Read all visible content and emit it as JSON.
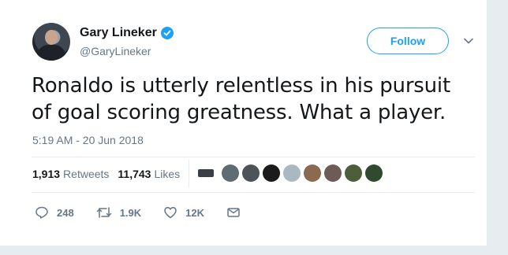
{
  "user": {
    "name": "Gary Lineker",
    "handle": "@GaryLineker"
  },
  "follow_label": "Follow",
  "tweet": {
    "text": "Ronaldo is utterly relentless in his pursuit of goal scoring greatness. What a player.",
    "timestamp": "5:19 AM - 20 Jun 2018"
  },
  "stats": {
    "retweets_count": "1,913",
    "retweets_label": "Retweets",
    "likes_count": "11,743",
    "likes_label": "Likes"
  },
  "actions": {
    "replies": "248",
    "retweets": "1.9K",
    "likes": "12K"
  },
  "liker_avatars": [
    {
      "color": "#3a3f45",
      "shape": "rect"
    },
    {
      "color": "#5d6d73"
    },
    {
      "color": "#4d5358"
    },
    {
      "color": "#1b1b1b"
    },
    {
      "color": "#aab8c2"
    },
    {
      "color": "#8b6a4f"
    },
    {
      "color": "#6e5b55"
    },
    {
      "color": "#4f5e3a"
    },
    {
      "color": "#2f4a2c"
    }
  ],
  "colors": {
    "accent": "#1da1f2",
    "secondary_text": "#657786"
  }
}
